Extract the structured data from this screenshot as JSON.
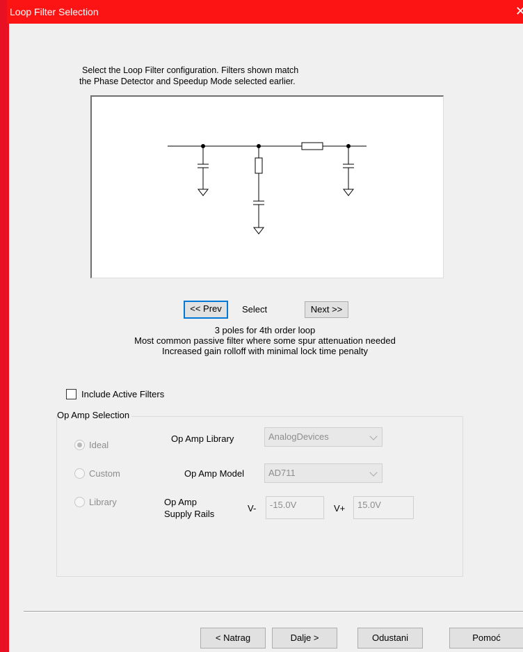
{
  "window": {
    "title": "Loop Filter Selection",
    "close_glyph": "✕"
  },
  "instructions": {
    "line1": "Select the Loop Filter configuration.   Filters shown match",
    "line2": "the Phase Detector and Speedup Mode selected earlier."
  },
  "navigation": {
    "prev_label": "<< Prev",
    "select_label": "Select",
    "next_label": "Next >>"
  },
  "filter_info": {
    "line1": "3 poles for 4th order loop",
    "line2": "Most common passive filter where some spur attenuation needed",
    "line3": "Increased gain rolloff with minimal lock time penalty"
  },
  "include_active": {
    "label": "Include Active Filters",
    "checked": false
  },
  "op_amp": {
    "group_label": "Op Amp Selection",
    "radio_ideal": "Ideal",
    "radio_custom": "Custom",
    "radio_library": "Library",
    "selected": "Ideal",
    "library_label": "Op Amp Library",
    "library_value": "AnalogDevices",
    "model_label": "Op Amp Model",
    "model_value": "AD711",
    "supply_label_1": "Op Amp",
    "supply_label_2": "Supply Rails",
    "vminus_label": "V-",
    "vminus_value": "-15.0V",
    "vplus_label": "V+",
    "vplus_value": "15.0V"
  },
  "footer": {
    "back_label": "< Natrag",
    "next_label": "Dalje >",
    "cancel_label": "Odustani",
    "help_label": "Pomoć"
  },
  "colors": {
    "titlebar": "#fc1414",
    "focus_border": "#0078d7",
    "window_bg": "#f0f0f0"
  }
}
